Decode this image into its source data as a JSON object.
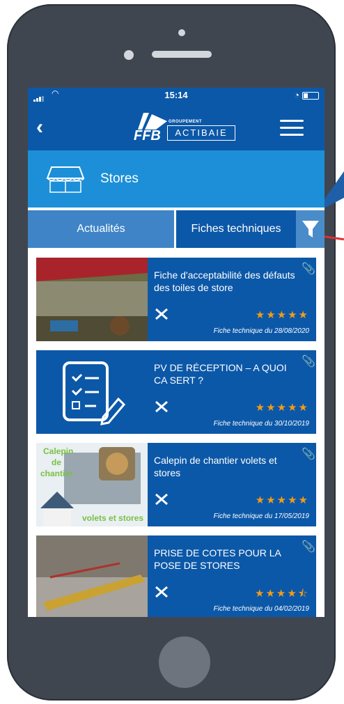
{
  "status_bar": {
    "time": "15:14"
  },
  "nav": {
    "brand": "FFB",
    "logo_top": "GROUPEMENT",
    "logo_main": "ACTIBAIE"
  },
  "section": {
    "title": "Stores"
  },
  "tabs": {
    "news": "Actualités",
    "sheets": "Fiches techniques"
  },
  "cards": [
    {
      "title": "Fiche d'acceptabilité des défauts des toiles de store",
      "stars": "★★★★★",
      "date": "Fiche technique du 28/08/2020"
    },
    {
      "title": "PV DE RÉCEPTION – A QUOI CA SERT ?",
      "stars": "★★★★★",
      "date": "Fiche technique du 30/10/2019"
    },
    {
      "title": "Calepin de chantier volets et stores",
      "stars": "★★★★★",
      "date": "Fiche technique du 17/05/2019",
      "thumb_text_1": "Calepin",
      "thumb_text_2": "de",
      "thumb_text_3": "chantier",
      "thumb_text_4": "volets et stores"
    },
    {
      "title": "PRISE DE COTES POUR LA POSE DE STORES",
      "stars": "★★★★⯪",
      "date": "Fiche technique du 04/02/2019"
    }
  ],
  "colors": {
    "primary": "#0c58a8",
    "accent": "#1c8fd8",
    "stars": "#f39b17",
    "phone": "#3f4650"
  }
}
